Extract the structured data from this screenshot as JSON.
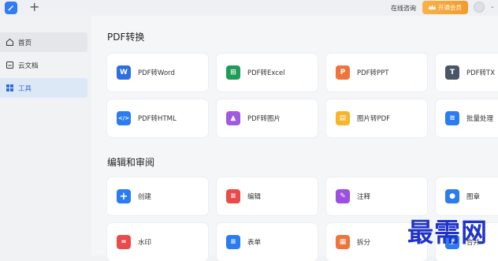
{
  "topbar": {
    "new_tab_label": "+",
    "consult_label": "在线咨询",
    "vip_label": "开通会员",
    "user_caret": "⌄"
  },
  "sidebar": {
    "items": [
      {
        "label": "首页",
        "icon": "home-icon"
      },
      {
        "label": "云文档",
        "icon": "cloud-doc-icon"
      },
      {
        "label": "工具",
        "icon": "tools-grid-icon"
      }
    ]
  },
  "sections": [
    {
      "title": "PDF转换",
      "cards": [
        {
          "label": "PDF转Word",
          "icon": "word-icon",
          "glyph": "W",
          "color": "#2b6fe0"
        },
        {
          "label": "PDF转Excel",
          "icon": "excel-icon",
          "glyph": "⊞",
          "color": "#1f9d55"
        },
        {
          "label": "PDF转PPT",
          "icon": "ppt-icon",
          "glyph": "P",
          "color": "#f0733a"
        },
        {
          "label": "PDF转TX",
          "icon": "txt-icon",
          "glyph": "T",
          "color": "#4a5566"
        },
        {
          "label": "PDF转HTML",
          "icon": "html-icon",
          "glyph": "</>",
          "color": "#2b7cf0"
        },
        {
          "label": "PDF转图片",
          "icon": "image-icon",
          "glyph": "▲",
          "color": "#a05ae0"
        },
        {
          "label": "图片转PDF",
          "icon": "image-to-pdf-icon",
          "glyph": "▤",
          "color": "#f5b52c"
        },
        {
          "label": "批量处理",
          "icon": "batch-icon",
          "glyph": "≋",
          "color": "#2b7cf0"
        }
      ]
    },
    {
      "title": "编辑和审阅",
      "cards": [
        {
          "label": "创建",
          "icon": "create-icon",
          "glyph": "+",
          "color": "#2b7cf0"
        },
        {
          "label": "编辑",
          "icon": "edit-icon",
          "glyph": "≡",
          "color": "#e94b4b"
        },
        {
          "label": "注释",
          "icon": "annotate-icon",
          "glyph": "✎",
          "color": "#9c4fe0"
        },
        {
          "label": "图章",
          "icon": "stamp-icon",
          "glyph": "●",
          "color": "#2b7cf0"
        },
        {
          "label": "水印",
          "icon": "watermark-icon",
          "glyph": "≈",
          "color": "#e94b4b"
        },
        {
          "label": "表单",
          "icon": "form-icon",
          "glyph": "≡",
          "color": "#2b7cf0"
        },
        {
          "label": "拆分",
          "icon": "split-icon",
          "glyph": "▦",
          "color": "#f0733a"
        },
        {
          "label": "合并",
          "icon": "merge-icon",
          "glyph": "▣",
          "color": "#2b7cf0"
        }
      ]
    }
  ],
  "watermark_text": "最需网"
}
